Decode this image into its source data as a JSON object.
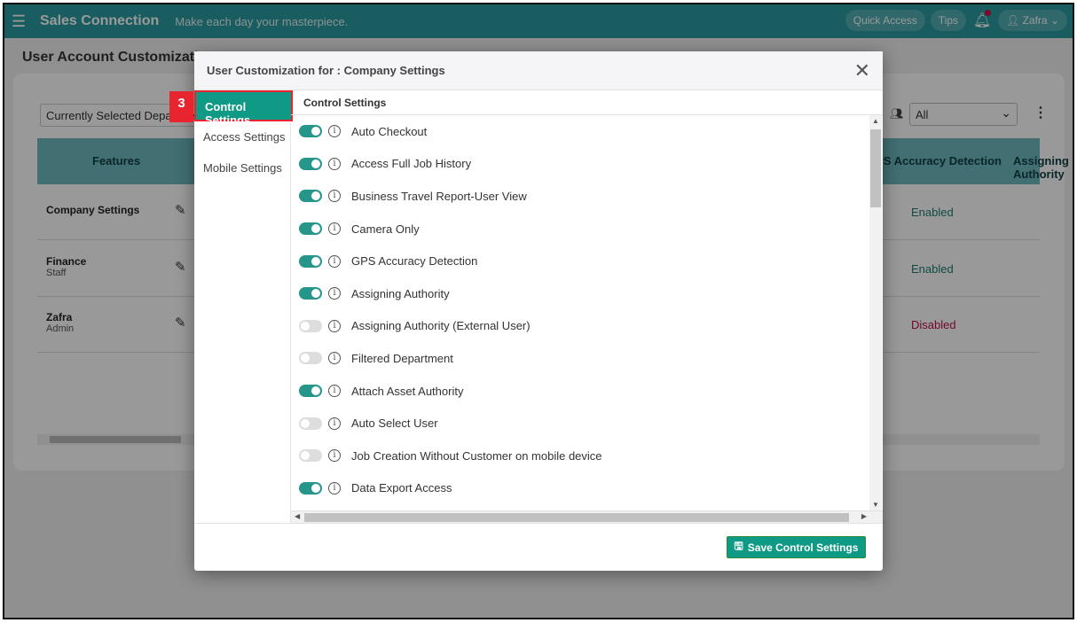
{
  "app": {
    "title": "Sales Connection",
    "tagline": "Make each day your masterpiece.",
    "quick_access": "Quick Access",
    "tips": "Tips",
    "user": "Zafra"
  },
  "page": {
    "title": "User Account Customization",
    "dept_placeholder": "Currently Selected Department",
    "filter_value": "All",
    "columns": [
      "Features",
      "GPS Accuracy Detection",
      "Assigning Authority"
    ],
    "rows": [
      {
        "name": "Company Settings",
        "role": "",
        "status": "Enabled"
      },
      {
        "name": "Finance",
        "role": "Staff",
        "status": "Enabled"
      },
      {
        "name": "Zafra",
        "role": "Admin",
        "status": "Disabled"
      }
    ]
  },
  "modal": {
    "title": "User Customization for : Company Settings",
    "step_badge": "3",
    "nav": [
      "Control Settings",
      "Access Settings",
      "Mobile Settings"
    ],
    "section_title": "Control Settings",
    "settings": [
      {
        "label": "Auto Checkout",
        "on": true
      },
      {
        "label": "Access Full Job History",
        "on": true
      },
      {
        "label": "Business Travel Report-User View",
        "on": true
      },
      {
        "label": "Camera Only",
        "on": true
      },
      {
        "label": "GPS Accuracy Detection",
        "on": true
      },
      {
        "label": "Assigning Authority",
        "on": true
      },
      {
        "label": "Assigning Authority (External User)",
        "on": false
      },
      {
        "label": "Filtered Department",
        "on": false
      },
      {
        "label": "Attach Asset Authority",
        "on": true
      },
      {
        "label": "Auto Select User",
        "on": false
      },
      {
        "label": "Job Creation Without Customer on mobile device",
        "on": false
      },
      {
        "label": "Data Export Access",
        "on": true
      }
    ],
    "save_label": "Save Control Settings"
  },
  "colors": {
    "accent": "#0f9a85",
    "enabled": "#1d7c74",
    "disabled": "#c0104c",
    "highlight": "#e8242e"
  }
}
